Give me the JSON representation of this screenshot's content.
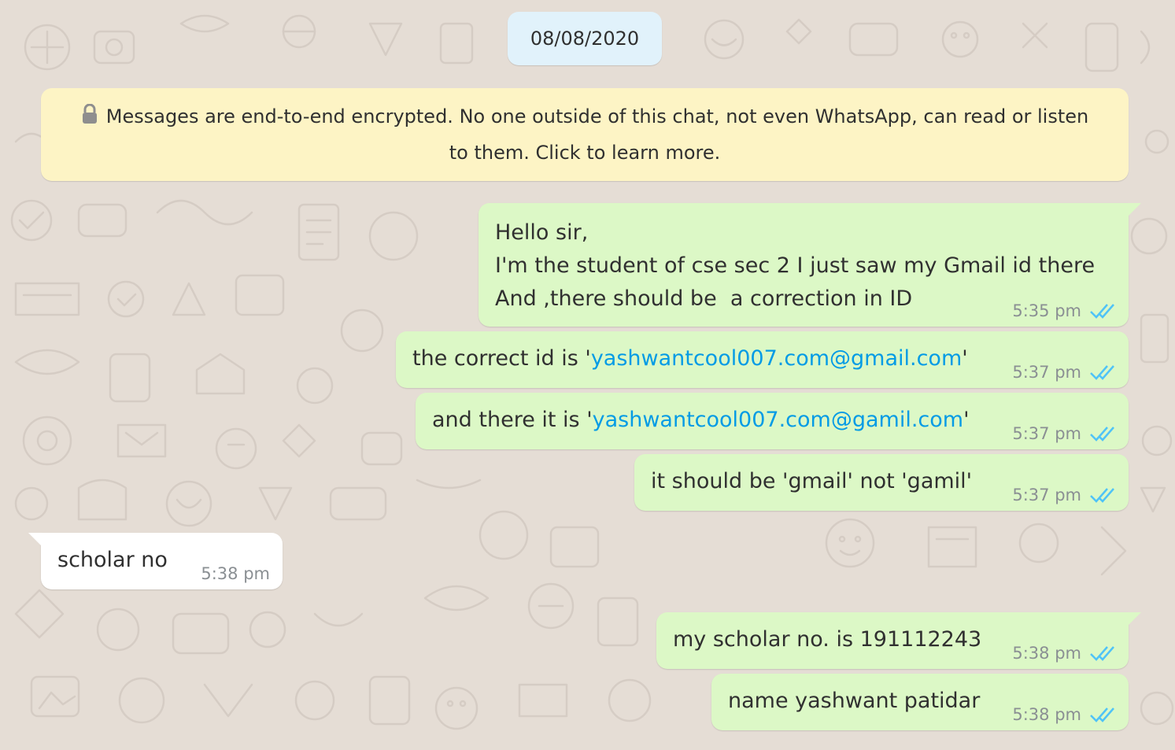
{
  "chat": {
    "date_chip": "08/08/2020",
    "encryption_notice": {
      "line1": "Messages are end-to-end encrypted. No one outside of this chat, not even WhatsApp, can read or listen",
      "line2": "to them. Click to learn more.",
      "icon": "lock-icon"
    },
    "colors": {
      "wallpaper": "#e5ddd5",
      "outgoing_bubble": "#dcf8c6",
      "incoming_bubble": "#ffffff",
      "date_chip": "#e1f2fb",
      "notice": "#fdf4c5",
      "link": "#039be5",
      "read_ticks": "#4fc3f7"
    },
    "messages": [
      {
        "direction": "outgoing",
        "lines": [
          "Hello sir,",
          "I'm the student of cse sec 2 I just saw my Gmail id there",
          "And ,there should be  a correction in ID"
        ],
        "time": "5:35 pm",
        "status": "read"
      },
      {
        "direction": "outgoing",
        "prefix": "the correct id is '",
        "link": "yashwantcool007.com@gmail.com",
        "suffix": "'",
        "time": "5:37 pm",
        "status": "read"
      },
      {
        "direction": "outgoing",
        "prefix": "and there it is '",
        "link": "yashwantcool007.com@gamil.com",
        "suffix": "'",
        "time": "5:37 pm",
        "status": "read"
      },
      {
        "direction": "outgoing",
        "text": "it should be 'gmail' not 'gamil'",
        "time": "5:37 pm",
        "status": "read"
      },
      {
        "direction": "incoming",
        "text": "scholar no",
        "time": "5:38 pm"
      },
      {
        "direction": "outgoing",
        "text": "my scholar no. is 191112243",
        "time": "5:38 pm",
        "status": "read"
      },
      {
        "direction": "outgoing",
        "text": "name yashwant patidar",
        "time": "5:38 pm",
        "status": "read"
      }
    ]
  }
}
